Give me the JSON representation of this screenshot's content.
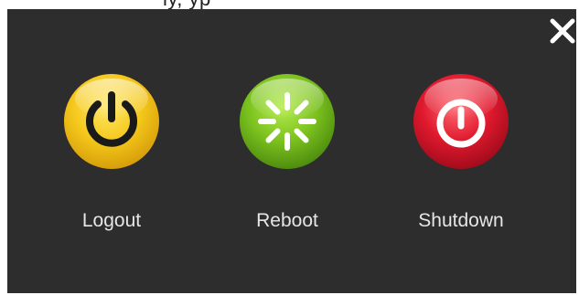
{
  "top_clip_text": "ly,                          yp",
  "dialog": {
    "close_icon": "close-x-icon",
    "options": [
      {
        "label": "Logout",
        "icon": "power-icon",
        "color": "#f2c21a"
      },
      {
        "label": "Reboot",
        "icon": "loading-spinner-icon",
        "color": "#7cc21f"
      },
      {
        "label": "Shutdown",
        "icon": "power-stop-icon",
        "color": "#e0192e"
      }
    ]
  },
  "colors": {
    "panel_bg": "#2d2d2d",
    "label_text": "#e6e6e6",
    "close_icon": "#ffffff"
  }
}
